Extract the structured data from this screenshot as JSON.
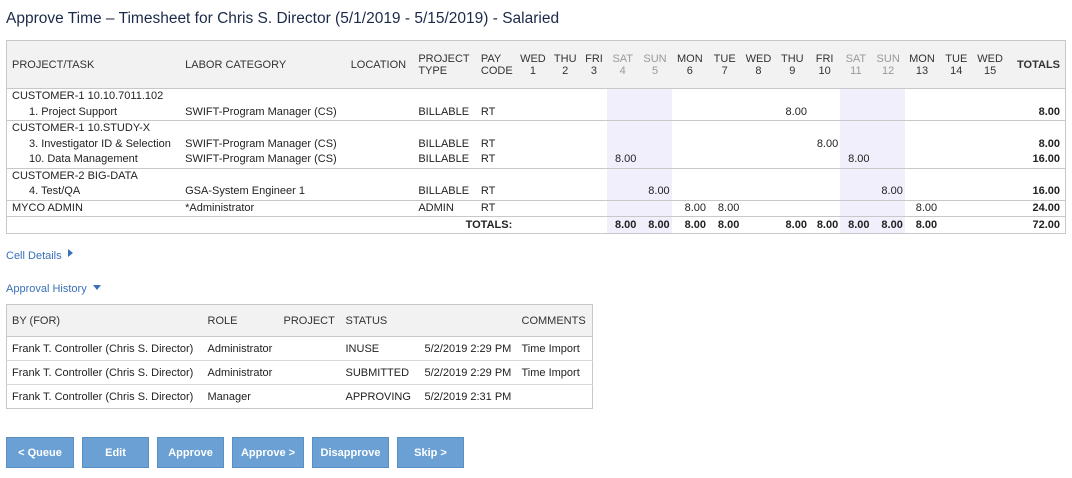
{
  "page": {
    "title": "Approve Time – Timesheet for Chris S. Director (5/1/2019 - 5/15/2019) - Salaried"
  },
  "timesheet": {
    "headers": {
      "project_task": "PROJECT/TASK",
      "labor_category": "LABOR CATEGORY",
      "location": "LOCATION",
      "project_type": [
        "PROJECT",
        "TYPE"
      ],
      "pay_code": [
        "PAY",
        "CODE"
      ],
      "totals": "TOTALS"
    },
    "days": [
      {
        "dow": "WED",
        "day": "1",
        "weekend": false
      },
      {
        "dow": "THU",
        "day": "2",
        "weekend": false
      },
      {
        "dow": "FRI",
        "day": "3",
        "weekend": false
      },
      {
        "dow": "SAT",
        "day": "4",
        "weekend": true
      },
      {
        "dow": "SUN",
        "day": "5",
        "weekend": true
      },
      {
        "dow": "MON",
        "day": "6",
        "weekend": false
      },
      {
        "dow": "TUE",
        "day": "7",
        "weekend": false
      },
      {
        "dow": "WED",
        "day": "8",
        "weekend": false
      },
      {
        "dow": "THU",
        "day": "9",
        "weekend": false
      },
      {
        "dow": "FRI",
        "day": "10",
        "weekend": false
      },
      {
        "dow": "SAT",
        "day": "11",
        "weekend": true
      },
      {
        "dow": "SUN",
        "day": "12",
        "weekend": true
      },
      {
        "dow": "MON",
        "day": "13",
        "weekend": false
      },
      {
        "dow": "TUE",
        "day": "14",
        "weekend": false
      },
      {
        "dow": "WED",
        "day": "15",
        "weekend": false
      }
    ],
    "groups": [
      {
        "name": "CUSTOMER-1 10.10.7011.102",
        "rows": [
          {
            "task": "1. Project Support",
            "labor": "SWIFT-Program Manager (CS)",
            "location": "",
            "ptype": "BILLABLE",
            "pay": "RT",
            "hours": [
              "",
              "",
              "",
              "",
              "",
              "",
              "",
              "",
              "8.00",
              "",
              "",
              "",
              "",
              "",
              ""
            ],
            "total": "8.00"
          }
        ]
      },
      {
        "name": "CUSTOMER-1 10.STUDY-X",
        "rows": [
          {
            "task": "3. Investigator ID & Selection",
            "labor": "SWIFT-Program Manager (CS)",
            "location": "",
            "ptype": "BILLABLE",
            "pay": "RT",
            "hours": [
              "",
              "",
              "",
              "",
              "",
              "",
              "",
              "",
              "",
              "8.00",
              "",
              "",
              "",
              "",
              ""
            ],
            "total": "8.00"
          },
          {
            "task": "10. Data Management",
            "labor": "SWIFT-Program Manager (CS)",
            "location": "",
            "ptype": "BILLABLE",
            "pay": "RT",
            "hours": [
              "",
              "",
              "",
              "8.00",
              "",
              "",
              "",
              "",
              "",
              "",
              "8.00",
              "",
              "",
              "",
              ""
            ],
            "total": "16.00"
          }
        ]
      },
      {
        "name": "CUSTOMER-2 BIG-DATA",
        "rows": [
          {
            "task": "4. Test/QA",
            "labor": "GSA-System Engineer 1",
            "location": "",
            "ptype": "BILLABLE",
            "pay": "RT",
            "hours": [
              "",
              "",
              "",
              "",
              "8.00",
              "",
              "",
              "",
              "",
              "",
              "",
              "8.00",
              "",
              "",
              ""
            ],
            "total": "16.00"
          }
        ]
      }
    ],
    "admin_row": {
      "task": "MYCO ADMIN",
      "labor": "*Administrator",
      "location": "",
      "ptype": "ADMIN",
      "pay": "RT",
      "hours": [
        "",
        "",
        "",
        "",
        "",
        "8.00",
        "8.00",
        "",
        "",
        "",
        "",
        "",
        "8.00",
        "",
        ""
      ],
      "total": "24.00"
    },
    "totals_row": {
      "label": "TOTALS:",
      "hours": [
        "",
        "",
        "",
        "8.00",
        "8.00",
        "8.00",
        "8.00",
        "",
        "8.00",
        "8.00",
        "8.00",
        "8.00",
        "8.00",
        "",
        ""
      ],
      "total": "72.00"
    }
  },
  "sections": {
    "cell_details": "Cell Details",
    "approval_history": "Approval History"
  },
  "approval_history": {
    "headers": {
      "by": "BY (FOR)",
      "role": "ROLE",
      "project": "PROJECT",
      "status": "STATUS",
      "date": "",
      "comments": "COMMENTS"
    },
    "rows": [
      {
        "by": "Frank T. Controller (Chris S. Director)",
        "role": "Administrator",
        "project": "",
        "status": "INUSE",
        "date": "5/2/2019 2:29 PM",
        "comments": "Time Import"
      },
      {
        "by": "Frank T. Controller (Chris S. Director)",
        "role": "Administrator",
        "project": "",
        "status": "SUBMITTED",
        "date": "5/2/2019 2:29 PM",
        "comments": "Time Import"
      },
      {
        "by": "Frank T. Controller (Chris S. Director)",
        "role": "Manager",
        "project": "",
        "status": "APPROVING",
        "date": "5/2/2019 2:31 PM",
        "comments": ""
      }
    ]
  },
  "buttons": {
    "queue": "< Queue",
    "edit": "Edit",
    "approve": "Approve",
    "approve_next": "Approve >",
    "disapprove": "Disapprove",
    "skip": "Skip >"
  },
  "colors": {
    "link": "#3a70b8",
    "button": "#6aa0d4",
    "weekend_shade": "#f1effc",
    "header_bg": "#f2f2f2"
  }
}
